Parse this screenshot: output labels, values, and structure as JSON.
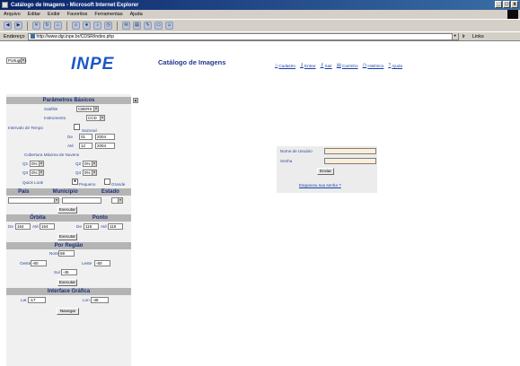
{
  "window": {
    "title": "Catálogo de Imagens - Microsoft Internet Explorer",
    "buttons": [
      "_",
      "□",
      "x"
    ]
  },
  "menubar": [
    "Arquivo",
    "Editar",
    "Exibir",
    "Favoritos",
    "Ferramentas",
    "Ajuda"
  ],
  "toolbar": {
    "icons": [
      "back-icon",
      "forward-icon",
      "stop-icon",
      "refresh-icon",
      "home-icon",
      "search-icon",
      "favorites-icon",
      "media-icon",
      "history-icon",
      "mail-icon",
      "print-icon",
      "edit-icon",
      "discuss-icon",
      "messenger-icon"
    ]
  },
  "addressbar": {
    "label": "Endereço",
    "url": "http://www.dgi.inpe.br/CDSR/index.php",
    "go_label": "Ir",
    "links_label": "Links"
  },
  "header": {
    "language": "Português",
    "logo": "INPE",
    "title": "Catálogo de Imagens",
    "nav": [
      {
        "label": "Cadastro",
        "icon": "house-icon"
      },
      {
        "label": "Entrar",
        "icon": "key-icon"
      },
      {
        "label": "Sair",
        "icon": "exit-icon"
      },
      {
        "label": "Carrinho",
        "icon": "cart-icon"
      },
      {
        "label": "Histórico",
        "icon": "history-icon"
      },
      {
        "label": "Ajuda",
        "icon": "help-icon"
      }
    ]
  },
  "params": {
    "heading": "Parâmetros Básicos",
    "satellite_label": "Satélite",
    "satellite_value": "CBERS 2",
    "instrument_label": "Instrumento",
    "instrument_value": "CCD",
    "interval_label": "Intervalo de Tempo",
    "seasonal_label": "Sazonal",
    "from_label": "De",
    "from_day": "01",
    "from_year": "2004",
    "to_label": "Até",
    "to_day": "12",
    "to_year": "2004",
    "cloud_label": "Cobertura Máxima de Nuvens",
    "q1": "Q1",
    "q2": "Q2",
    "q3": "Q3",
    "q4": "Q4",
    "q_value": "0%",
    "quicklook_label": "Quick Look",
    "small_label": "Pequeno",
    "large_label": "Grande"
  },
  "location": {
    "country": "País",
    "city": "Município",
    "state": "Estado",
    "search": "Executar"
  },
  "orbit": {
    "heading": "Órbita",
    "point_heading": "Ponto",
    "from_label": "De",
    "from_value": "164",
    "to_label": "Até",
    "to_value": "164",
    "p_from_label": "De",
    "p_from_value": "118",
    "p_to_label": "Até",
    "p_to_value": "118",
    "search": "Executar"
  },
  "region": {
    "heading": "Por Região",
    "north_label": "Norte",
    "north_value": "58",
    "west_label": "Oeste",
    "west_value": "-60",
    "east_label": "Leste",
    "east_value": "-50",
    "south_label": "Sul",
    "south_value": "-45",
    "search": "Executar"
  },
  "graphic": {
    "heading": "Interface Gráfica",
    "lat_label": "Lat",
    "lat_value": "-17",
    "lon_label": "Lon",
    "lon_value": "-48",
    "navigate": "Navegar"
  },
  "login": {
    "user_label": "Nome de Usuário",
    "password_label": "Senha",
    "submit": "Enviar",
    "forgot": "Esqueceu sua senha ?"
  }
}
